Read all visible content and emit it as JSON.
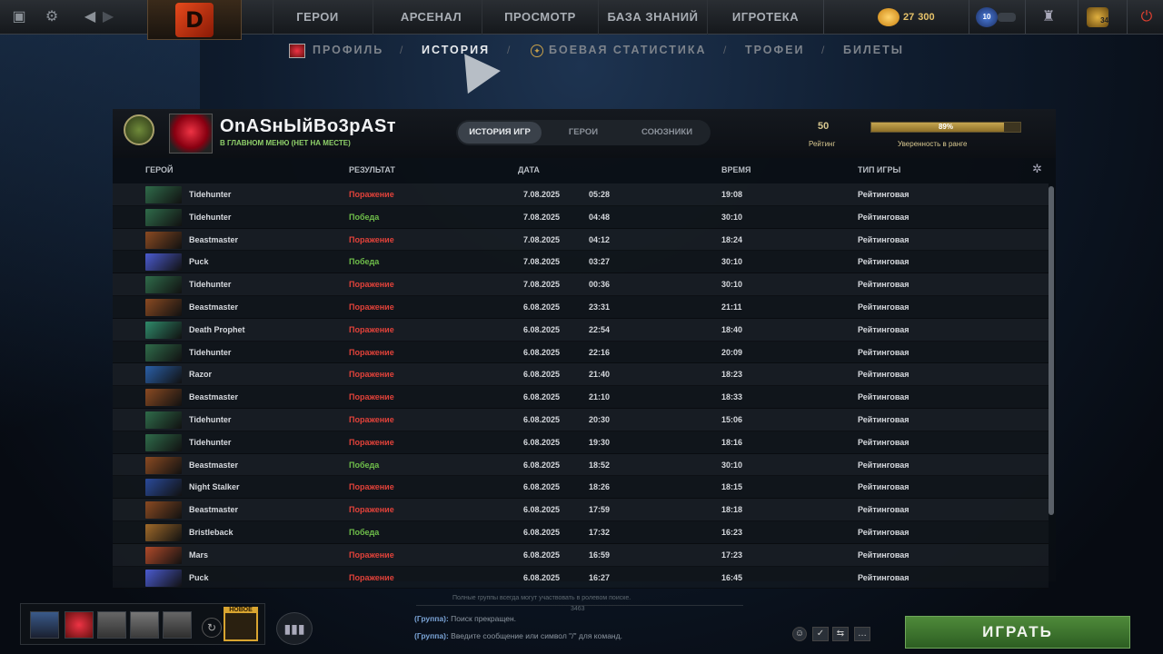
{
  "topbar": {
    "nav": [
      "ГЕРОИ",
      "АРСЕНАЛ",
      "ПРОСМОТР",
      "БАЗА ЗНАНИЙ",
      "ИГРОТЕКА"
    ],
    "coins_a": "27",
    "coins_b": "300",
    "notif_count": "10",
    "level_badge": "34"
  },
  "subnav": {
    "items": [
      "ПРОФИЛЬ",
      "ИСТОРИЯ",
      "БОЕВАЯ СТАТИСТИКА",
      "ТРОФЕИ",
      "БИЛЕТЫ"
    ],
    "separator": "/"
  },
  "profile": {
    "name": "OnASнЫйВо3рASт",
    "status": "В ГЛАВНОМ МЕНЮ (НЕТ НА МЕСТЕ)",
    "tabs": [
      "ИСТОРИЯ ИГР",
      "ГЕРОИ",
      "СОЮЗНИКИ"
    ],
    "rating_value": "50",
    "rating_label": "Рейтинг",
    "confidence_pct_text": "89%",
    "confidence_fraction": 0.89,
    "confidence_label": "Уверенность в ранге"
  },
  "table": {
    "headers": [
      "ГЕРОЙ",
      "РЕЗУЛЬТАТ",
      "ДАТА",
      "ВРЕМЯ",
      "ТИП ИГРЫ"
    ],
    "rows": [
      {
        "hero": "Tidehunter",
        "result": "Поражение",
        "win": false,
        "date": "7.08.2025",
        "time": "05:28",
        "duration": "19:08",
        "type": "Рейтинговая",
        "color": "#2f6b4a"
      },
      {
        "hero": "Tidehunter",
        "result": "Победа",
        "win": true,
        "date": "7.08.2025",
        "time": "04:48",
        "duration": "30:10",
        "type": "Рейтинговая",
        "color": "#2f6b4a"
      },
      {
        "hero": "Beastmaster",
        "result": "Поражение",
        "win": false,
        "date": "7.08.2025",
        "time": "04:12",
        "duration": "18:24",
        "type": "Рейтинговая",
        "color": "#8a4a22"
      },
      {
        "hero": "Puck",
        "result": "Победа",
        "win": true,
        "date": "7.08.2025",
        "time": "03:27",
        "duration": "30:10",
        "type": "Рейтинговая",
        "color": "#4b5bd0"
      },
      {
        "hero": "Tidehunter",
        "result": "Поражение",
        "win": false,
        "date": "7.08.2025",
        "time": "00:36",
        "duration": "30:10",
        "type": "Рейтинговая",
        "color": "#2f6b4a"
      },
      {
        "hero": "Beastmaster",
        "result": "Поражение",
        "win": false,
        "date": "6.08.2025",
        "time": "23:31",
        "duration": "21:11",
        "type": "Рейтинговая",
        "color": "#8a4a22"
      },
      {
        "hero": "Death Prophet",
        "result": "Поражение",
        "win": false,
        "date": "6.08.2025",
        "time": "22:54",
        "duration": "18:40",
        "type": "Рейтинговая",
        "color": "#2f8a6a"
      },
      {
        "hero": "Tidehunter",
        "result": "Поражение",
        "win": false,
        "date": "6.08.2025",
        "time": "22:16",
        "duration": "20:09",
        "type": "Рейтинговая",
        "color": "#2f6b4a"
      },
      {
        "hero": "Razor",
        "result": "Поражение",
        "win": false,
        "date": "6.08.2025",
        "time": "21:40",
        "duration": "18:23",
        "type": "Рейтинговая",
        "color": "#2a5fa8"
      },
      {
        "hero": "Beastmaster",
        "result": "Поражение",
        "win": false,
        "date": "6.08.2025",
        "time": "21:10",
        "duration": "18:33",
        "type": "Рейтинговая",
        "color": "#8a4a22"
      },
      {
        "hero": "Tidehunter",
        "result": "Поражение",
        "win": false,
        "date": "6.08.2025",
        "time": "20:30",
        "duration": "15:06",
        "type": "Рейтинговая",
        "color": "#2f6b4a"
      },
      {
        "hero": "Tidehunter",
        "result": "Поражение",
        "win": false,
        "date": "6.08.2025",
        "time": "19:30",
        "duration": "18:16",
        "type": "Рейтинговая",
        "color": "#2f6b4a"
      },
      {
        "hero": "Beastmaster",
        "result": "Победа",
        "win": true,
        "date": "6.08.2025",
        "time": "18:52",
        "duration": "30:10",
        "type": "Рейтинговая",
        "color": "#8a4a22"
      },
      {
        "hero": "Night Stalker",
        "result": "Поражение",
        "win": false,
        "date": "6.08.2025",
        "time": "18:26",
        "duration": "18:15",
        "type": "Рейтинговая",
        "color": "#2a4a9a"
      },
      {
        "hero": "Beastmaster",
        "result": "Поражение",
        "win": false,
        "date": "6.08.2025",
        "time": "17:59",
        "duration": "18:18",
        "type": "Рейтинговая",
        "color": "#8a4a22"
      },
      {
        "hero": "Bristleback",
        "result": "Победа",
        "win": true,
        "date": "6.08.2025",
        "time": "17:32",
        "duration": "16:23",
        "type": "Рейтинговая",
        "color": "#a06a2a"
      },
      {
        "hero": "Mars",
        "result": "Поражение",
        "win": false,
        "date": "6.08.2025",
        "time": "16:59",
        "duration": "17:23",
        "type": "Рейтинговая",
        "color": "#b04a2a"
      },
      {
        "hero": "Puck",
        "result": "Поражение",
        "win": false,
        "date": "6.08.2025",
        "time": "16:27",
        "duration": "16:45",
        "type": "Рейтинговая",
        "color": "#4b5bd0"
      }
    ]
  },
  "bottom": {
    "new_badge": "НОВОЕ",
    "chat_note": "Полные группы всегда могут участвовать в ролевом поиске.",
    "chat_note2": "3463",
    "chat_line1_prefix": "(Группа):",
    "chat_line1": "Поиск прекращен.",
    "chat_line2_prefix": "(Группа):",
    "chat_line2": "Введите сообщение или символ \"/\" для команд.",
    "play_label": "ИГРАТЬ"
  }
}
